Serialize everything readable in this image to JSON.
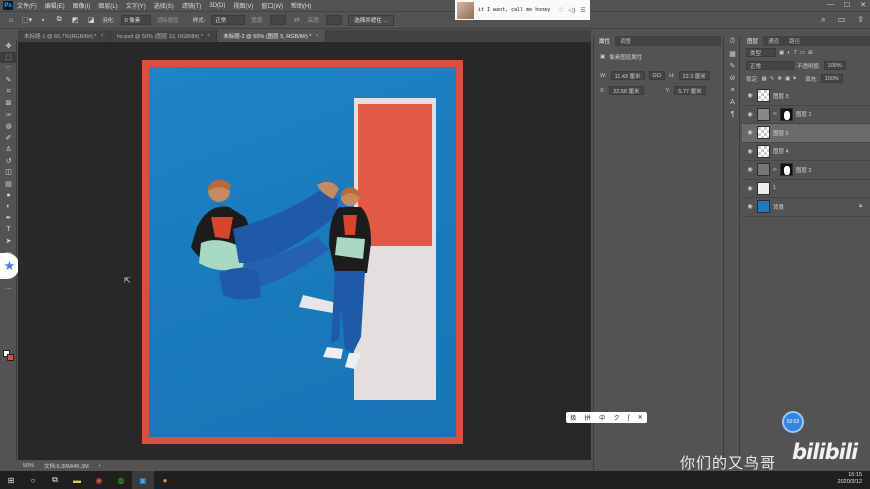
{
  "menubar": {
    "app_logo": "Ps",
    "items": [
      "文件(F)",
      "编辑(E)",
      "图像(I)",
      "图层(L)",
      "文字(Y)",
      "选择(S)",
      "滤镜(T)",
      "3D(D)",
      "视图(V)",
      "窗口(W)",
      "帮助(H)"
    ],
    "controls": [
      "—",
      "☐",
      "✕"
    ]
  },
  "options": {
    "feather_label": "羽化:",
    "feather_value": "0 像素",
    "antialias": "消除锯齿",
    "style_label": "样式:",
    "style_value": "正常",
    "width_label": "宽度:",
    "height_label": "高度:",
    "select_mask_button": "选择并遮住 ..."
  },
  "tabs": [
    {
      "label": "未标题-1 @ 66.7%(RGB/8#) *",
      "close": "×",
      "active": false
    },
    {
      "label": "ho.psd @ 50% (图层 12, RGB/8#) *",
      "close": "×",
      "active": false
    },
    {
      "label": "未标题-2 @ 50% (图层 5, RGB/8#) *",
      "close": "×",
      "active": true
    }
  ],
  "tools": [
    "move-icon",
    "marquee-icon",
    "lasso-icon",
    "quick-select-icon",
    "crop-icon",
    "frame-icon",
    "eyedropper-icon",
    "healing-icon",
    "brush-icon",
    "stamp-icon",
    "history-brush-icon",
    "eraser-icon",
    "gradient-icon",
    "blur-icon",
    "dodge-icon",
    "pen-icon",
    "type-icon",
    "path-select-icon",
    "shape-icon",
    "hand-icon",
    "zoom-icon",
    "more-icon"
  ],
  "colors": {
    "canvas_frame": "#dc4e3f",
    "canvas_bg": "#1a7bbd",
    "paper": "#e4dede",
    "paper_red": "#e05a45",
    "fg_swatch": "#ffffff",
    "bg_swatch": "#dc4e3f"
  },
  "status": {
    "zoom": "50%",
    "doc": "文档:6.30M/46.3M"
  },
  "properties": {
    "tabs": [
      "属性",
      "调整"
    ],
    "subtitle": "像素图层属性",
    "w_label": "W:",
    "w_value": "11.43 厘米",
    "link_label": "GO",
    "h_label": "H:",
    "h_value": "22.3 厘米",
    "x_label": "X:",
    "x_value": "22.58 厘米",
    "y_label": "Y:",
    "y_value": "5.77 厘米"
  },
  "layers": {
    "tabs": [
      "图层",
      "通道",
      "路径"
    ],
    "kind_label": "类型",
    "blend_mode": "正常",
    "opacity_label": "不透明度:",
    "opacity_value": "100%",
    "lock_label": "锁定:",
    "fill_label": "填充:",
    "fill_value": "100%",
    "items": [
      {
        "name": "图层 3",
        "has_mask": false,
        "selected": false
      },
      {
        "name": "图层 1",
        "has_mask": true,
        "selected": false
      },
      {
        "name": "图层 5",
        "has_mask": false,
        "selected": true
      },
      {
        "name": "图层 4",
        "has_mask": false,
        "selected": false
      },
      {
        "name": "图层 2",
        "has_mask": true,
        "selected": false
      },
      {
        "name": "1",
        "has_mask": false,
        "selected": false
      },
      {
        "name": "背景",
        "has_mask": false,
        "selected": false
      }
    ]
  },
  "music": {
    "title": "it I want, call me honey",
    "ctrls": [
      "♡",
      "◁)",
      "☰"
    ]
  },
  "floating_toolbar": [
    "极",
    "拼",
    "中",
    "ク",
    "ʃ",
    "✕"
  ],
  "badge": "02:02",
  "watermark": "你们的又鸟哥",
  "bilibili": "bilibili",
  "clock": {
    "time": "16:15",
    "date": "2020/3/12"
  }
}
